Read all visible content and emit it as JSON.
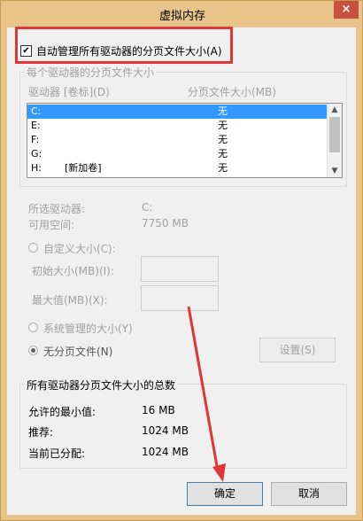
{
  "window": {
    "title": "虚拟内存",
    "close_glyph": "×"
  },
  "auto_manage": {
    "checked": true,
    "check_glyph": "✔",
    "label": "自动管理所有驱动器的分页文件大小(A)"
  },
  "drives_group": {
    "title": "每个驱动器的分页文件大小",
    "col_drive": "驱动器 [卷标](D)",
    "col_size": "分页文件大小(MB)",
    "rows": [
      {
        "drive": "C:",
        "label": "",
        "size": "无",
        "selected": true
      },
      {
        "drive": "E:",
        "label": "",
        "size": "无"
      },
      {
        "drive": "F:",
        "label": "",
        "size": "无"
      },
      {
        "drive": "G:",
        "label": "",
        "size": "无"
      },
      {
        "drive": "H:",
        "label": "[新加卷]",
        "size": "无"
      }
    ]
  },
  "selected_drive": {
    "label": "所选驱动器:",
    "value": "C:"
  },
  "free_space": {
    "label": "可用空间:",
    "value": "7750 MB"
  },
  "options": {
    "custom": "自定义大小(C):",
    "initial": "初始大小(MB)(I):",
    "max": "最大值(MB)(X):",
    "system_managed": "系统管理的大小(Y)",
    "no_paging": "无分页文件(N)",
    "set_button": "设置(S)"
  },
  "totals_group": {
    "title": "所有驱动器分页文件大小的总数",
    "min_label": "允许的最小值:",
    "min_value": "16 MB",
    "rec_label": "推荐:",
    "rec_value": "1024 MB",
    "cur_label": "当前已分配:",
    "cur_value": "1024 MB"
  },
  "buttons": {
    "ok": "确定",
    "cancel": "取消"
  },
  "colors": {
    "title_bar": "#e9c48a",
    "highlight": "#e03636",
    "selection": "#3399ff"
  },
  "scroll_glyphs": {
    "up": "▲",
    "down": "▼"
  }
}
